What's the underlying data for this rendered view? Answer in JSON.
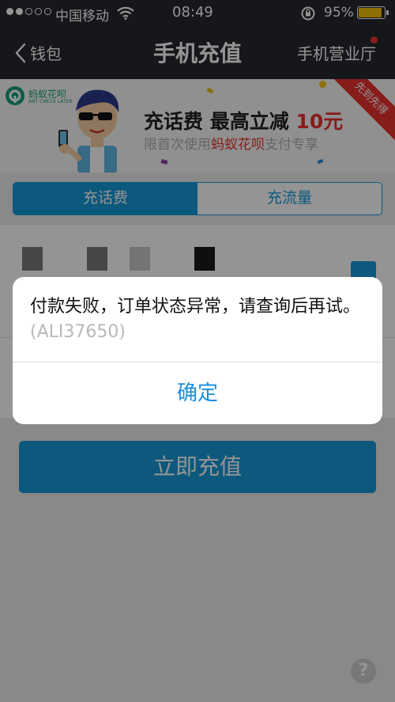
{
  "status_bar": {
    "carrier": "中国移动",
    "time": "08:49",
    "battery_pct": "95%",
    "battery_level": 0.95
  },
  "nav": {
    "back_label": "钱包",
    "title": "手机充值",
    "right_label": "手机营业厅"
  },
  "banner": {
    "logo_name": "蚂蚁花呗",
    "logo_sub": "ANT CHECK LATER",
    "headline_prefix": "充话费 最高立减 ",
    "headline_amount": "10元",
    "subline_prefix": "限首次使用",
    "subline_brand": "蚂蚁花呗",
    "subline_suffix": "支付专享",
    "ribbon": "先到先得"
  },
  "tabs": [
    {
      "label": "充话费",
      "active": true
    },
    {
      "label": "充流量",
      "active": false
    }
  ],
  "recharge_button": "立即充值",
  "help_icon_glyph": "?",
  "alert": {
    "message": "付款失败，订单状态异常，请查询后再试。",
    "code": "(ALI37650)",
    "ok_label": "确定"
  },
  "colors": {
    "accent": "#1799d9",
    "navbar": "#27282d",
    "promo_red": "#e8312f",
    "battery": "#f6c20a"
  }
}
